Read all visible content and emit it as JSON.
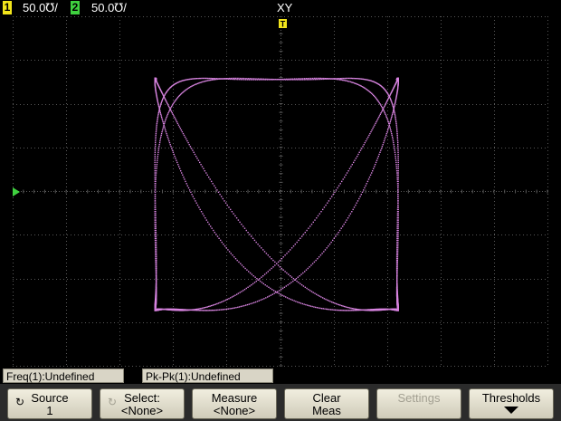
{
  "topbar": {
    "ch1_num": "1",
    "ch1_scale": "50.0℧/",
    "ch2_num": "2",
    "ch2_scale": "50.0℧/",
    "mode": "XY"
  },
  "colors": {
    "ch1": "#f2e51b",
    "ch2": "#3fd13f",
    "trace": "#d884e0",
    "grid": "#575757"
  },
  "plot": {
    "trigger_marker": "T",
    "ground_marker": "2"
  },
  "measurements": [
    "Freq(1):Undefined",
    "Pk-Pk(1):Undefined"
  ],
  "softkeys": [
    {
      "line1": "Source",
      "line2": "1",
      "icon": "rotate-knob-icon",
      "enabled": true
    },
    {
      "line1": "Select:",
      "line2": "<None>",
      "icon": "rotate-knob-icon",
      "enabled": false
    },
    {
      "line1": "Measure",
      "line2": "<None>",
      "enabled": true
    },
    {
      "line1": "Clear",
      "line2": "Meas",
      "enabled": true
    },
    {
      "line1": "Settings",
      "line2": "",
      "enabled": false
    },
    {
      "line1": "Thresholds",
      "line2": "",
      "icon": "down-arrow-icon",
      "enabled": true
    }
  ]
}
